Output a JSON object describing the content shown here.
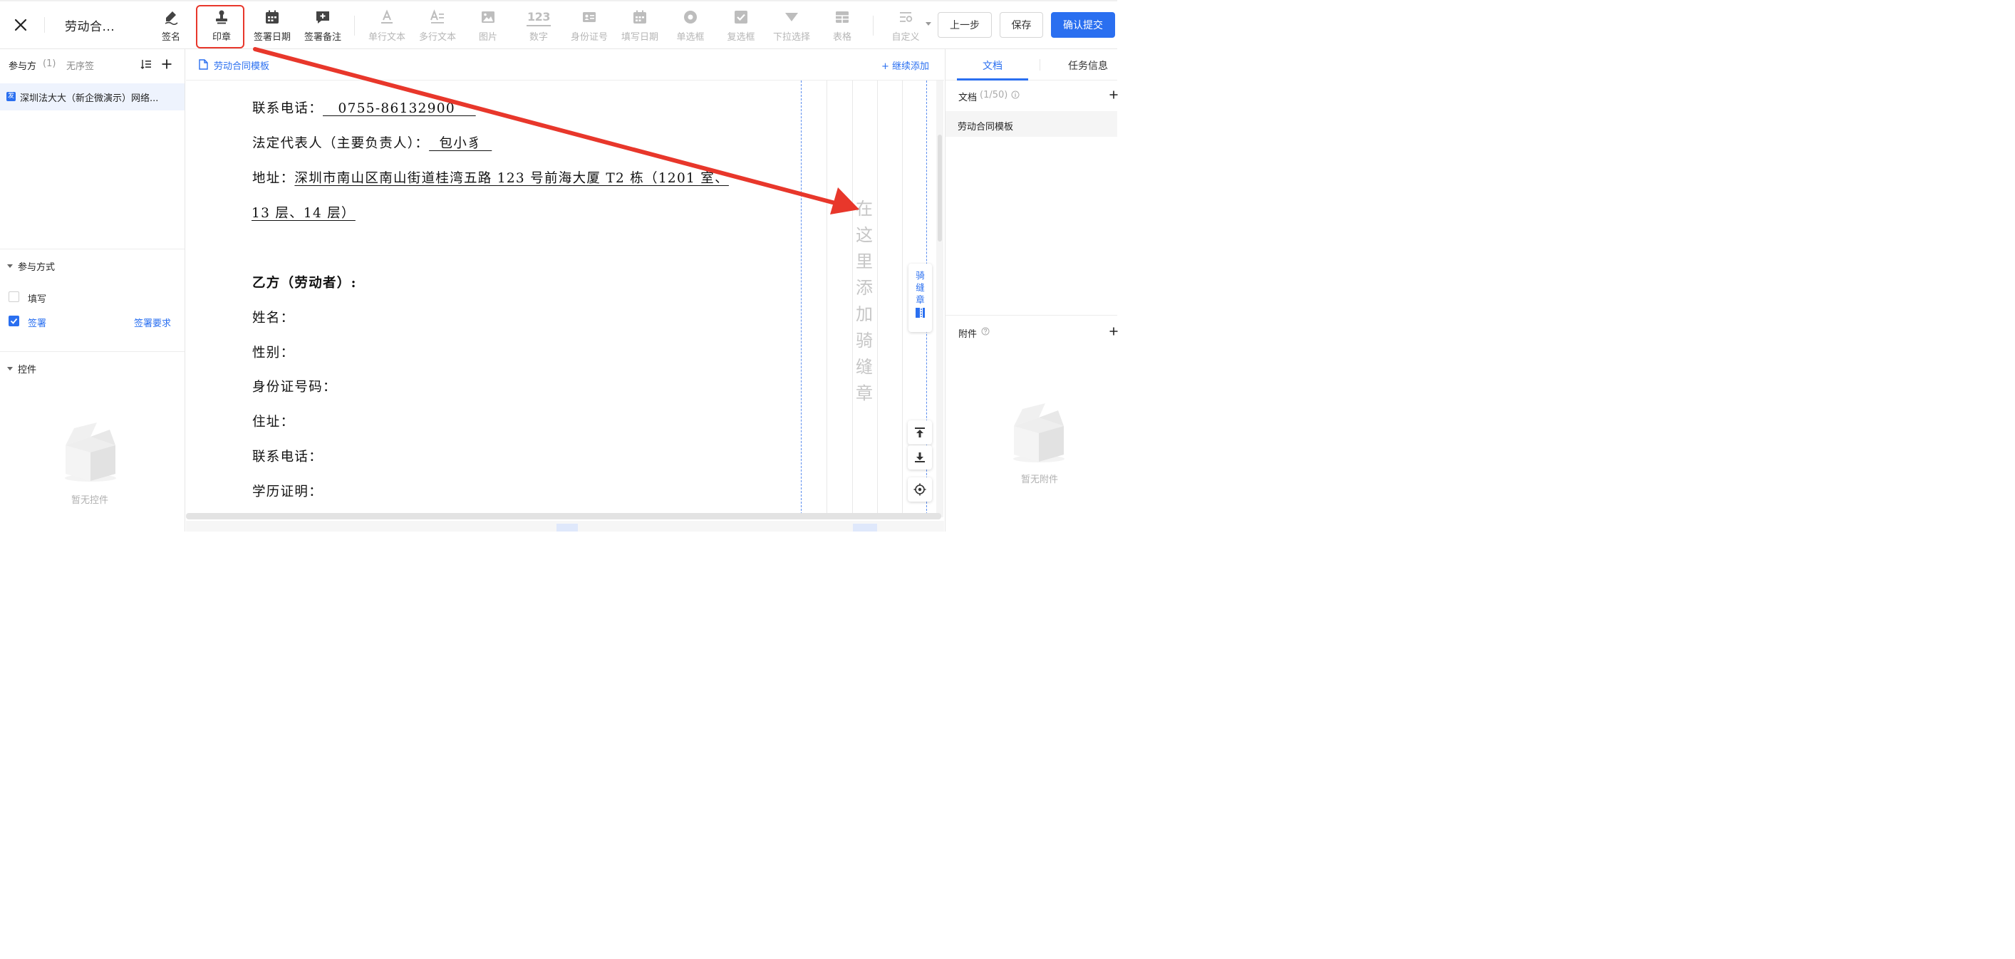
{
  "header": {
    "title": "劳动合...",
    "tools": [
      {
        "label": "签名",
        "icon": "signature-pen-icon",
        "enabled": true
      },
      {
        "label": "印章",
        "icon": "stamp-icon",
        "enabled": true,
        "selected": true
      },
      {
        "label": "签署日期",
        "icon": "calendar-icon",
        "enabled": true
      },
      {
        "label": "签署备注",
        "icon": "note-plus-icon",
        "enabled": true
      },
      {
        "label": "单行文本",
        "icon": "single-line-text-icon",
        "enabled": false
      },
      {
        "label": "多行文本",
        "icon": "multi-line-text-icon",
        "enabled": false
      },
      {
        "label": "图片",
        "icon": "image-icon",
        "enabled": false
      },
      {
        "label": "数字",
        "icon": "number-icon",
        "enabled": false
      },
      {
        "label": "身份证号",
        "icon": "id-card-icon",
        "enabled": false
      },
      {
        "label": "填写日期",
        "icon": "fill-date-icon",
        "enabled": false
      },
      {
        "label": "单选框",
        "icon": "radio-icon",
        "enabled": false
      },
      {
        "label": "复选框",
        "icon": "checkbox-icon",
        "enabled": false
      },
      {
        "label": "下拉选择",
        "icon": "dropdown-icon",
        "enabled": false
      },
      {
        "label": "表格",
        "icon": "table-icon",
        "enabled": false
      },
      {
        "label": "自定义",
        "icon": "custom-icon",
        "enabled": false
      }
    ],
    "icon_123": "123",
    "buttons": {
      "prev": "上一步",
      "save": "保存",
      "confirm": "确认提交"
    }
  },
  "left_panel": {
    "participants_label": "参与方",
    "participants_count": "(1)",
    "order_mode": "无序签",
    "party_badge": "发",
    "party_name": "深圳法大大（新企微演示）网络...",
    "participation": {
      "title": "参与方式",
      "fill_label": "填写",
      "fill_checked": false,
      "sign_label": "签署",
      "sign_checked": true,
      "sign_requirement_link": "签署要求"
    },
    "controls": {
      "title": "控件",
      "empty_text": "暂无控件"
    }
  },
  "document": {
    "template_link": "劳动合同模板",
    "add_more": "+ 继续添加",
    "lines": {
      "phone_a": {
        "label": "联系电话：",
        "value": "   0755-86132900    "
      },
      "legal_rep": {
        "label": "法定代表人（主要负责人）：",
        "value": "  包小豸  "
      },
      "address": {
        "label": "地址：",
        "value": "深圳市南山区南山街道桂湾五路 123 号前海大厦 T2 栋（1201 室、"
      },
      "address_cont": "13 层、14 层）",
      "party_b": "乙方（劳动者）:",
      "name": "姓名：",
      "gender": "性别：",
      "id_number": "身份证号码：",
      "residence": "住址：",
      "phone_b": "联系电话：",
      "education": "学历证明："
    },
    "seam_placeholder": [
      "在",
      "这",
      "里",
      "添",
      "加",
      "骑",
      "缝",
      "章"
    ],
    "seam_button": [
      "骑",
      "缝",
      "章"
    ],
    "accent_red": "#e8372b",
    "accent_blue": "#2a6ff0"
  },
  "right_panel": {
    "tabs": [
      "文档",
      "任务信息"
    ],
    "active_tab": "文档",
    "docs_label": "文档",
    "docs_count": "(1/50)",
    "doc_item": "劳动合同模板",
    "attachments_label": "附件",
    "attachments_empty": "暂无附件"
  }
}
